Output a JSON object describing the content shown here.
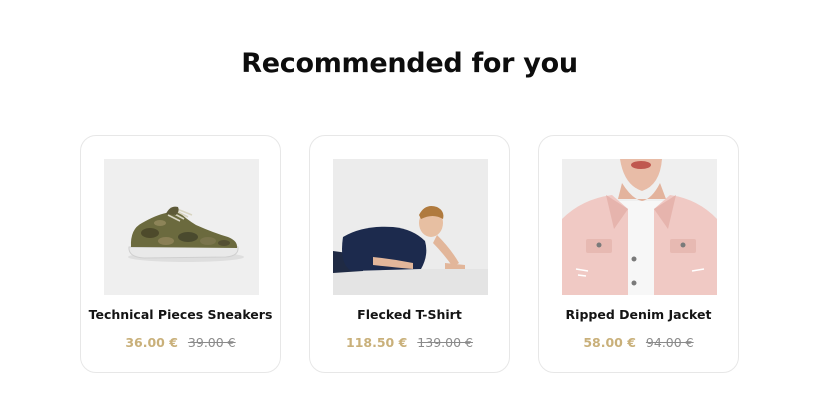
{
  "section": {
    "title": "Recommended for you"
  },
  "colors": {
    "sale_price": "#c9b07a",
    "old_price": "#8a8a8a",
    "card_border": "#e7e7e7"
  },
  "products": [
    {
      "name": "Technical Pieces Sneakers",
      "price": "36.00 €",
      "old_price": "39.00 €",
      "image": "camo-sneaker-image"
    },
    {
      "name": "Flecked T-Shirt",
      "price": "118.50 €",
      "old_price": "139.00 €",
      "image": "man-lying-tshirt-image"
    },
    {
      "name": "Ripped Denim Jacket",
      "price": "58.00 €",
      "old_price": "94.00 €",
      "image": "pink-denim-jacket-image"
    }
  ]
}
